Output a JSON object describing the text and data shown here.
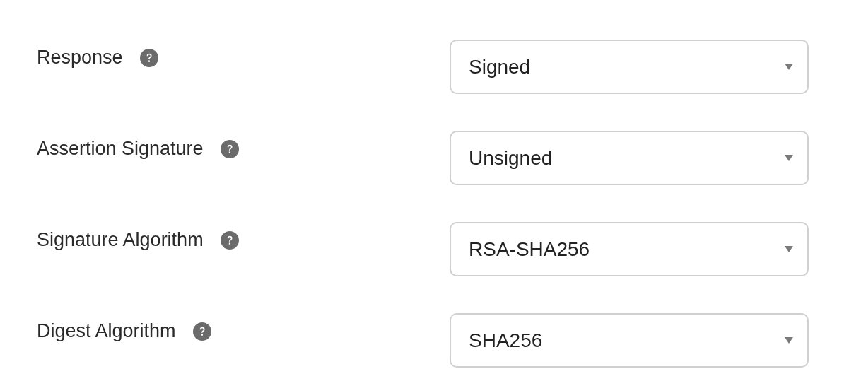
{
  "fields": [
    {
      "label": "Response",
      "value": "Signed"
    },
    {
      "label": "Assertion Signature",
      "value": "Unsigned"
    },
    {
      "label": "Signature Algorithm",
      "value": "RSA-SHA256"
    },
    {
      "label": "Digest Algorithm",
      "value": "SHA256"
    }
  ]
}
